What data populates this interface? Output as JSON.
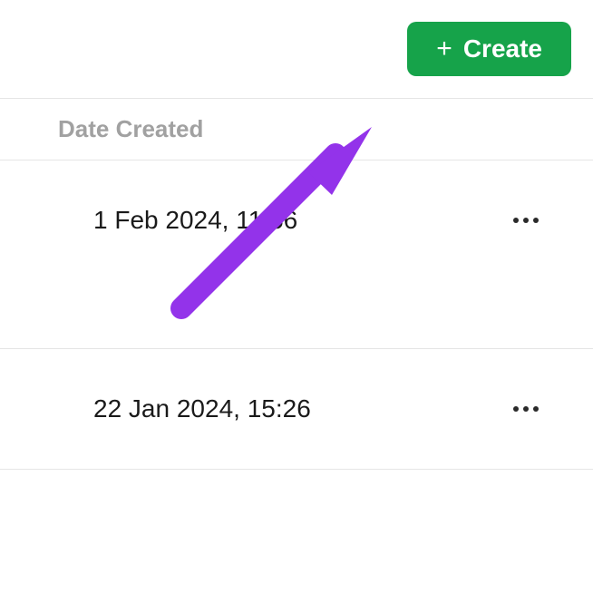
{
  "toolbar": {
    "create_label": "Create"
  },
  "table": {
    "header": {
      "date_created_label": "Date Created"
    },
    "rows": [
      {
        "date": "1 Feb 2024, 11:56"
      },
      {
        "date": "22 Jan 2024, 15:26"
      }
    ]
  },
  "annotation": {
    "arrow_color": "#9333ea"
  }
}
